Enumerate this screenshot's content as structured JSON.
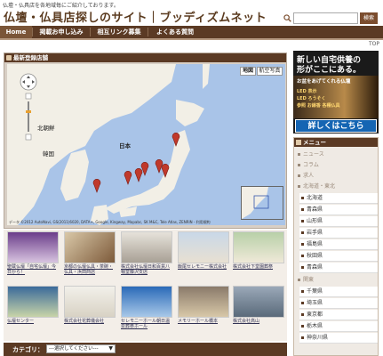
{
  "header": {
    "tagline": "仏壇・仏具店を各地域毎にご紹介しております。",
    "title": "仏壇・仏具店探しのサイト｜ブッディズムネット",
    "search": {
      "placeholder": "",
      "button_label": "検索"
    }
  },
  "nav": {
    "items": [
      {
        "label": "Home",
        "active": true
      },
      {
        "label": "掲載お申し込み",
        "active": false
      },
      {
        "label": "相互リンク募集",
        "active": false
      },
      {
        "label": "よくある質問",
        "active": false
      }
    ],
    "top_link": "TOP"
  },
  "map_panel": {
    "title": "最新登録店舗",
    "buttons": {
      "map": "地図",
      "satellite": "航空写真"
    },
    "labels": {
      "north_korea": "北朝鮮",
      "south_korea": "韓国",
      "japan": "日本"
    },
    "attribution": "データ ©2012 AutoNavi, GS(2011)6020, DATA+, Google, Kingway, Mapabc, SK M&C, Tele Atlas, ZENRIN - 利用規約"
  },
  "thumbnails": [
    {
      "caption": "聖蔵仏壇「自宅仏壇」今日から！"
    },
    {
      "caption": "京都の仏壇仏具・茶碗・仏具・浜田商店"
    },
    {
      "caption": "株式会社仏壇日和百貨八幡堂藤沢支店"
    },
    {
      "caption": "飯尾セレモニー株式会社"
    },
    {
      "caption": "株式会社下堂園葬祭"
    },
    {
      "caption": "仏壇センター"
    },
    {
      "caption": "株式会社花葬儀会社"
    },
    {
      "caption": "セレモニーホール朝日温泉葬祭ホール"
    },
    {
      "caption": "メモリーホール橋本"
    },
    {
      "caption": "株式会社高山"
    }
  ],
  "category": {
    "label": "カテゴリ：",
    "selected": "---選択してください---"
  },
  "banner": {
    "line1": "新しい自宅供養の",
    "line2": "形がここにある。",
    "line3": "お盆をあげてくれる仏壇",
    "line4": "LED 表示",
    "line5": "LED ろうそく",
    "line6": "参照 お線香 各種仏具",
    "button": "詳しくはこちら"
  },
  "menu": {
    "title": "メニュー",
    "items": [
      {
        "label": "ニュース",
        "sub": false
      },
      {
        "label": "コラム",
        "sub": false
      },
      {
        "label": "求人",
        "sub": false
      },
      {
        "label": "北海道・東北",
        "sub": false
      },
      {
        "label": "北海道",
        "sub": true
      },
      {
        "label": "青森県",
        "sub": true
      },
      {
        "label": "山形県",
        "sub": true
      },
      {
        "label": "岩手県",
        "sub": true
      },
      {
        "label": "福島県",
        "sub": true
      },
      {
        "label": "秋田県",
        "sub": true
      },
      {
        "label": "青森県",
        "sub": true
      },
      {
        "label": "関東",
        "sub": false
      },
      {
        "label": "千葉県",
        "sub": true
      },
      {
        "label": "埼玉県",
        "sub": true
      },
      {
        "label": "東京都",
        "sub": true
      },
      {
        "label": "栃木県",
        "sub": true
      },
      {
        "label": "神奈川県",
        "sub": true
      }
    ]
  },
  "colors": {
    "brand_brown": "#5b3a24",
    "accent_blue": "#1565b3",
    "map_sea": "#a9c4e8",
    "map_land": "#f2efe6",
    "marker_red": "#c0392b"
  },
  "icons": [
    "search-icon",
    "map-pan-control-icon",
    "map-zoom-icon",
    "map-marker-icon",
    "menu-header-icon"
  ]
}
